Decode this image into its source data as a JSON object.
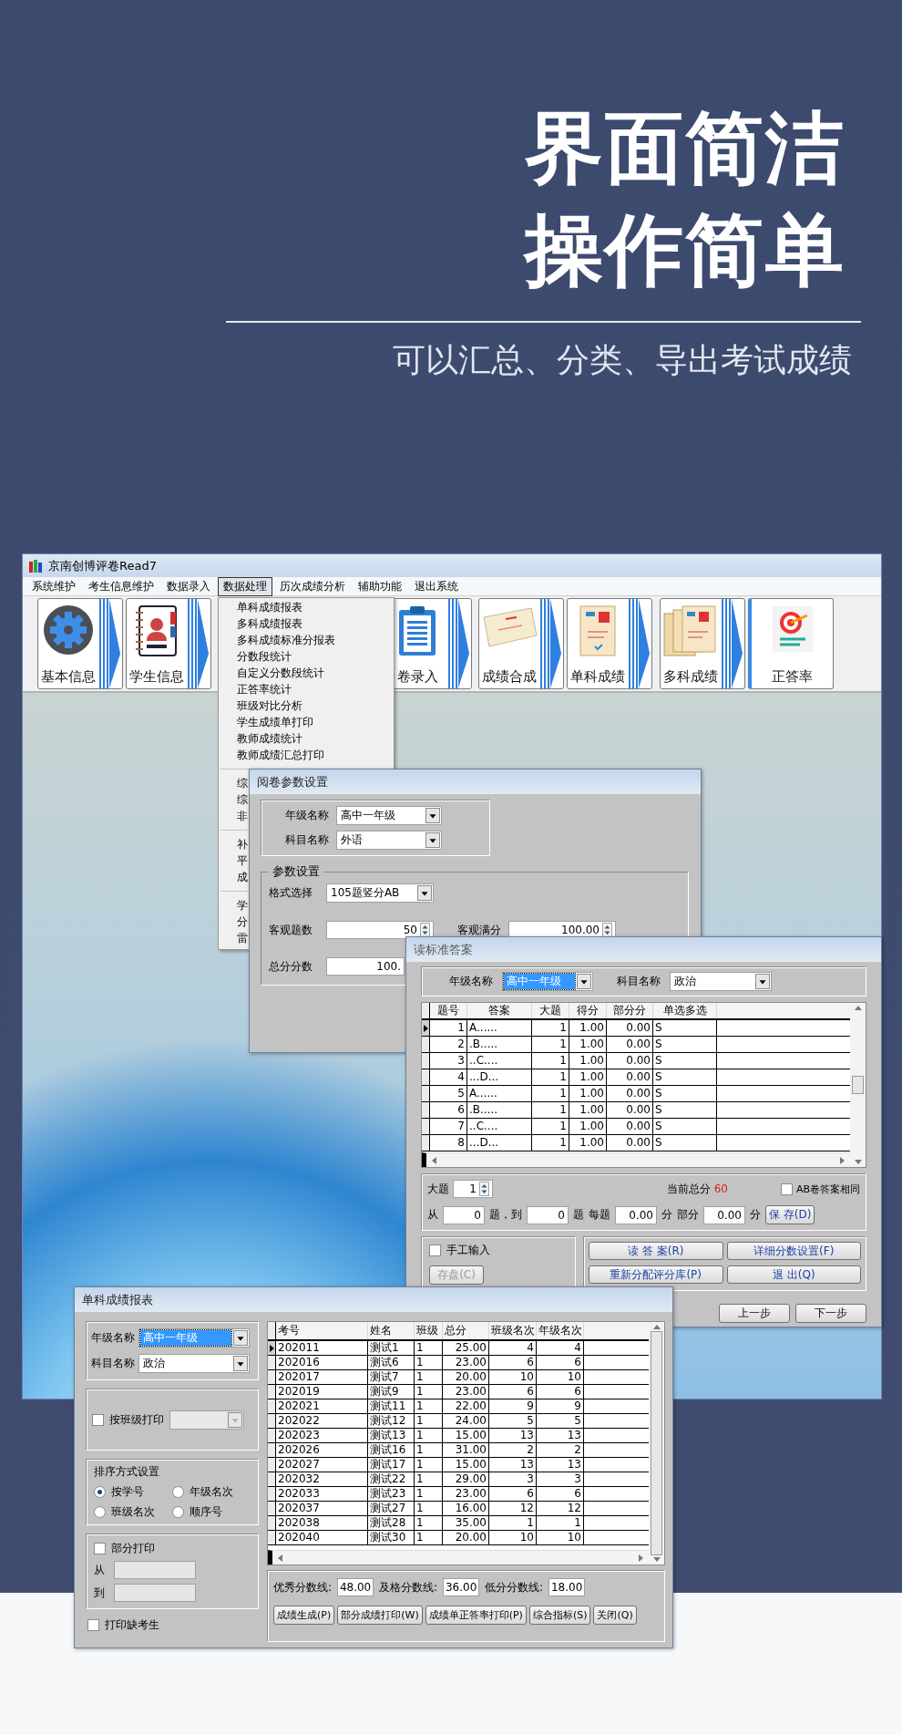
{
  "banner": {
    "headline": [
      "界面简洁",
      "操作简单"
    ],
    "subtitle": "可以汇总、分类、导出考试成绩"
  },
  "app": {
    "title": "京南创博评卷Read7",
    "menu": [
      {
        "label": "系统维护",
        "selected": false
      },
      {
        "label": "考生信息维护",
        "selected": false
      },
      {
        "label": "数据录入",
        "selected": false
      },
      {
        "label": "数据处理",
        "selected": true
      },
      {
        "label": "历次成绩分析",
        "selected": false
      },
      {
        "label": "辅助功能",
        "selected": false
      },
      {
        "label": "退出系统",
        "selected": false
      }
    ],
    "toolbar": [
      {
        "label": "基本信息",
        "kind": "gear"
      },
      {
        "label": "学生信息",
        "kind": "contacts"
      },
      {
        "label": "卷录入",
        "kind": "clipboard"
      },
      {
        "label": "成绩合成",
        "kind": "ticket"
      },
      {
        "label": "单科成绩",
        "kind": "sheet"
      },
      {
        "label": "多科成绩",
        "kind": "sheets"
      },
      {
        "label": "正答率",
        "kind": "target"
      }
    ],
    "dropdown": [
      [
        "单科成绩报表",
        "多科成绩报表",
        "多科成绩标准分报表",
        "分数段统计",
        "自定义分数段统计",
        "正答率统计",
        "班级对比分析",
        "学生成绩单打印",
        "教师成绩统计",
        "教师成绩汇总打印"
      ],
      [
        "综",
        "综",
        "非"
      ],
      [
        "补",
        "平",
        "成"
      ],
      [
        "学",
        "分",
        "雷"
      ]
    ]
  },
  "params_dialog": {
    "title": "阅卷参数设置",
    "grade": {
      "label": "年级名称",
      "value": "高中一年级"
    },
    "subject": {
      "label": "科目名称",
      "value": "外语"
    },
    "group_title": "参数设置",
    "format": {
      "label": "格式选择",
      "value": "105题竖分AB"
    },
    "objective_count": {
      "label": "客观题数",
      "value": "50"
    },
    "objective_full": {
      "label": "客观满分",
      "value": "100.00"
    },
    "total": {
      "label": "总分分数",
      "value": "100."
    }
  },
  "answer_dialog": {
    "title": "读标准答案",
    "grade": {
      "label": "年级名称",
      "value": "高中一年级",
      "focused": true
    },
    "subject": {
      "label": "科目名称",
      "value": "政治",
      "focused": false
    },
    "columns": [
      "题号",
      "答案",
      "大题",
      "得分",
      "部分分",
      "单选多选"
    ],
    "rows": [
      {
        "cells": [
          "1",
          "A......",
          "1",
          "1.00",
          "0.00",
          "S"
        ],
        "current": true
      },
      {
        "cells": [
          "2",
          ".B.....",
          "1",
          "1.00",
          "0.00",
          "S"
        ],
        "current": false
      },
      {
        "cells": [
          "3",
          "..C....",
          "1",
          "1.00",
          "0.00",
          "S"
        ],
        "current": false
      },
      {
        "cells": [
          "4",
          "...D...",
          "1",
          "1.00",
          "0.00",
          "S"
        ],
        "current": false
      },
      {
        "cells": [
          "5",
          "A......",
          "1",
          "1.00",
          "0.00",
          "S"
        ],
        "current": false
      },
      {
        "cells": [
          "6",
          ".B.....",
          "1",
          "1.00",
          "0.00",
          "S"
        ],
        "current": false
      },
      {
        "cells": [
          "7",
          "..C....",
          "1",
          "1.00",
          "0.00",
          "S"
        ],
        "current": false
      },
      {
        "cells": [
          "8",
          "...D...",
          "1",
          "1.00",
          "0.00",
          "S"
        ],
        "current": false
      }
    ],
    "section": {
      "label": "大题",
      "value": "1"
    },
    "total": {
      "label": "当前总分",
      "value": "60"
    },
    "ab_same": {
      "label": "AB卷答案相同",
      "checked": false
    },
    "range": {
      "from_label": "从",
      "from": "0",
      "to_label": "题，到",
      "to": "0",
      "unit": "题",
      "each_label": "每题",
      "each": "0.00",
      "each_unit": "分",
      "partial_label": "部分",
      "partial": "0.00",
      "partial_unit": "分"
    },
    "save": "保 存(D)",
    "manual": {
      "label": "手工输入",
      "checked": false
    },
    "store": {
      "label": "存盘(C)",
      "disabled": true
    },
    "actions": [
      "读 答 案(R)",
      "详细分数设置(F)",
      "重新分配评分库(P)",
      "退 出(Q)"
    ],
    "nav": [
      "上一步",
      "下一步"
    ]
  },
  "report_dialog": {
    "title": "单科成绩报表",
    "grade": {
      "label": "年级名称",
      "value": "高中一年级",
      "focused": true
    },
    "subject": {
      "label": "科目名称",
      "value": "政治",
      "focused": false
    },
    "class_print": {
      "label": "按班级打印",
      "checked": false
    },
    "sort": {
      "title": "排序方式设置",
      "options": [
        {
          "label": "按学号",
          "selected": true
        },
        {
          "label": "年级名次",
          "selected": false
        },
        {
          "label": "班级名次",
          "selected": false
        },
        {
          "label": "顺序号",
          "selected": false
        }
      ]
    },
    "partial_print": {
      "label": "部分打印",
      "checked": false,
      "from_label": "从",
      "to_label": "到"
    },
    "absent": {
      "label": "打印缺考生",
      "checked": false
    },
    "columns": [
      "考号",
      "姓名",
      "班级",
      "总分",
      "班级名次",
      "年级名次"
    ],
    "rows": [
      {
        "cells": [
          "202011",
          "测试1",
          "1",
          "25.00",
          "4",
          "4"
        ],
        "current": true
      },
      {
        "cells": [
          "202016",
          "测试6",
          "1",
          "23.00",
          "6",
          "6"
        ],
        "current": false
      },
      {
        "cells": [
          "202017",
          "测试7",
          "1",
          "20.00",
          "10",
          "10"
        ],
        "current": false
      },
      {
        "cells": [
          "202019",
          "测试9",
          "1",
          "23.00",
          "6",
          "6"
        ],
        "current": false
      },
      {
        "cells": [
          "202021",
          "测试11",
          "1",
          "22.00",
          "9",
          "9"
        ],
        "current": false
      },
      {
        "cells": [
          "202022",
          "测试12",
          "1",
          "24.00",
          "5",
          "5"
        ],
        "current": false
      },
      {
        "cells": [
          "202023",
          "测试13",
          "1",
          "15.00",
          "13",
          "13"
        ],
        "current": false
      },
      {
        "cells": [
          "202026",
          "测试16",
          "1",
          "31.00",
          "2",
          "2"
        ],
        "current": false
      },
      {
        "cells": [
          "202027",
          "测试17",
          "1",
          "15.00",
          "13",
          "13"
        ],
        "current": false
      },
      {
        "cells": [
          "202032",
          "测试22",
          "1",
          "29.00",
          "3",
          "3"
        ],
        "current": false
      },
      {
        "cells": [
          "202033",
          "测试23",
          "1",
          "23.00",
          "6",
          "6"
        ],
        "current": false
      },
      {
        "cells": [
          "202037",
          "测试27",
          "1",
          "16.00",
          "12",
          "12"
        ],
        "current": false
      },
      {
        "cells": [
          "202038",
          "测试28",
          "1",
          "35.00",
          "1",
          "1"
        ],
        "current": false
      },
      {
        "cells": [
          "202040",
          "测试30",
          "1",
          "20.00",
          "10",
          "10"
        ],
        "current": false
      }
    ],
    "thresholds": [
      {
        "label": "优秀分数线:",
        "value": "48.00"
      },
      {
        "label": "及格分数线:",
        "value": "36.00"
      },
      {
        "label": "低分分数线:",
        "value": "18.00"
      }
    ],
    "actions": [
      "成绩生成(P)",
      "部分成绩打印(W)",
      "成绩单正答率打印(P)",
      "综合指标(S)",
      "关闭(Q)"
    ]
  }
}
